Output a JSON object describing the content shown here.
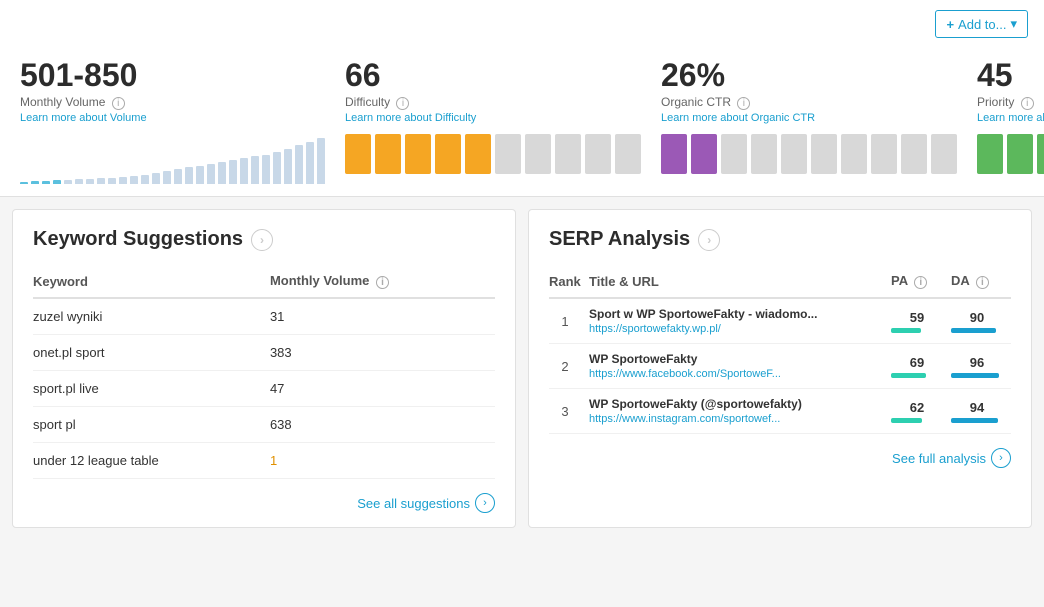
{
  "topbar": {
    "add_button_label": "Add to...",
    "add_button_icon": "+"
  },
  "metrics": [
    {
      "id": "monthly-volume",
      "value": "501-850",
      "label": "Monthly Volume",
      "link": "Learn more about Volume",
      "chart_type": "volume"
    },
    {
      "id": "difficulty",
      "value": "66",
      "label": "Difficulty",
      "link": "Learn more about Difficulty",
      "chart_type": "difficulty",
      "filled": 5,
      "total": 10,
      "color": "#f5a623"
    },
    {
      "id": "organic-ctr",
      "value": "26%",
      "label": "Organic CTR",
      "link": "Learn more about Organic CTR",
      "chart_type": "ctr",
      "filled": 2,
      "total": 10,
      "color": "#9b59b6"
    },
    {
      "id": "priority",
      "value": "45",
      "label": "Priority",
      "link": "Learn more about Priority",
      "chart_type": "priority",
      "filled": 3,
      "total": 10,
      "color": "#5cb85c"
    }
  ],
  "keyword_suggestions": {
    "title": "Keyword Suggestions",
    "column_keyword": "Keyword",
    "column_volume": "Monthly Volume",
    "rows": [
      {
        "keyword": "zuzel wyniki",
        "volume": "31",
        "low": false
      },
      {
        "keyword": "onet.pl sport",
        "volume": "383",
        "low": false
      },
      {
        "keyword": "sport.pl live",
        "volume": "47",
        "low": false
      },
      {
        "keyword": "sport pl",
        "volume": "638",
        "low": false
      },
      {
        "keyword": "under 12 league table",
        "volume": "1",
        "low": true
      }
    ],
    "see_all_label": "See all suggestions"
  },
  "serp_analysis": {
    "title": "SERP Analysis",
    "column_rank": "Rank",
    "column_title_url": "Title & URL",
    "column_pa": "PA",
    "column_da": "DA",
    "rows": [
      {
        "rank": "1",
        "title": "Sport w WP SportoweFakty - wiadomо...",
        "url": "https://sportowefakty.wp.pl/",
        "pa": "59",
        "da": "90",
        "pa_bar": 59,
        "da_bar": 90
      },
      {
        "rank": "2",
        "title": "WP SportoweFakty",
        "url": "https://www.facebook.com/SportoweF...",
        "pa": "69",
        "da": "96",
        "pa_bar": 69,
        "da_bar": 96
      },
      {
        "rank": "3",
        "title": "WP SportoweFakty (@sportowefakty)",
        "url": "https://www.instagram.com/sportowef...",
        "pa": "62",
        "da": "94",
        "pa_bar": 62,
        "da_bar": 94
      }
    ],
    "see_full_label": "See full analysis"
  },
  "volume_bars": [
    2,
    3,
    3,
    4,
    4,
    5,
    5,
    6,
    7,
    8,
    9,
    10,
    12,
    14,
    16,
    18,
    20,
    22,
    24,
    26,
    28,
    30,
    32,
    35,
    38,
    42,
    46,
    50
  ],
  "info_icon_label": "i"
}
